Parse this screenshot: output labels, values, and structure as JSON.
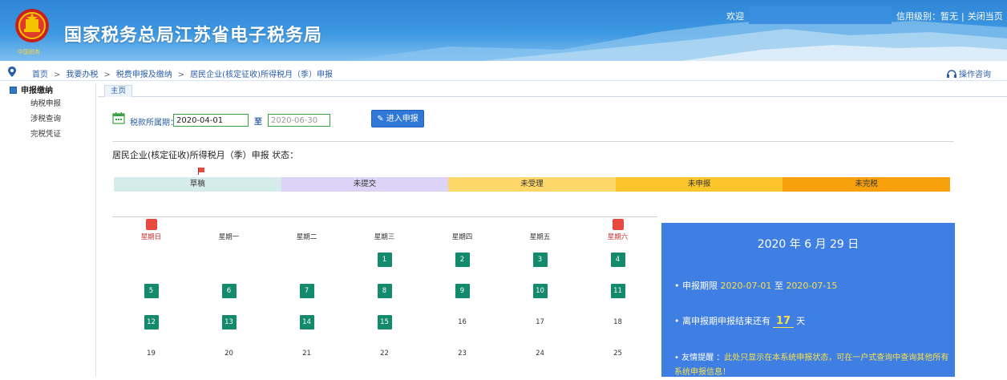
{
  "header": {
    "site_title": "国家税务总局江苏省电子税务局",
    "emblem_caption": "中国税务",
    "welcome": "欢迎",
    "credit_label": "信用级别：暂无",
    "separator": "|",
    "close_link": "关闭当页"
  },
  "breadcrumb": {
    "items": [
      "首页",
      "我要办税",
      "税费申报及缴纳",
      "居民企业(核定征收)所得税月（季）申报"
    ],
    "separator": ">",
    "help_link": "操作咨询"
  },
  "sidebar": {
    "section": "申报缴纳",
    "items": [
      "纳税申报",
      "涉税查询",
      "完税凭证"
    ]
  },
  "tabs": [
    "主页"
  ],
  "period": {
    "label": "税款所属期：",
    "start": "2020-04-01",
    "to": "至",
    "end": "2020-06-30",
    "enter_button": "进入申报"
  },
  "status_title": "居民企业(核定征收)所得税月（季）申报 状态：",
  "legend": [
    {
      "label": "草稿",
      "color": "#d6ecec"
    },
    {
      "label": "未提交",
      "color": "#dcd4f6"
    },
    {
      "label": "未受理",
      "color": "#fdd76a"
    },
    {
      "label": "未申报",
      "color": "#fbc52b"
    },
    {
      "label": "未完税",
      "color": "#f9a10d"
    }
  ],
  "calendar": {
    "weekdays": [
      "星期日",
      "星期一",
      "星期二",
      "星期三",
      "星期四",
      "星期五",
      "星期六"
    ],
    "weeks": [
      [
        null,
        null,
        null,
        "1",
        "2",
        "3",
        "4"
      ],
      [
        "5",
        "6",
        "7",
        "8",
        "9",
        "10",
        "11"
      ],
      [
        "12",
        "13",
        "14",
        "15",
        "16",
        "17",
        "18"
      ],
      [
        "19",
        "20",
        "21",
        "22",
        "23",
        "24",
        "25"
      ]
    ],
    "highlighted_through": 15
  },
  "info": {
    "date": "2020 年 6 月 29 日",
    "deadline_label": "• 申报期限",
    "deadline_start": "2020-07-01",
    "deadline_to": "至",
    "deadline_end": "2020-07-15",
    "remaining_prefix": "• 离申报期申报结束还有",
    "remaining_days": "17",
    "remaining_suffix": "天",
    "tip_label": "• 友情提醒 ：",
    "tip_text": "此处只显示在本系统申报状态，可在一户式查询中查询其他所有系统申报信息！"
  },
  "colors": {
    "banner": "#3d98e2",
    "calendar_day": "#138a6b",
    "info_panel": "#3f7fe3",
    "accent_yellow": "#f8e04a",
    "weekend": "#d03030"
  }
}
